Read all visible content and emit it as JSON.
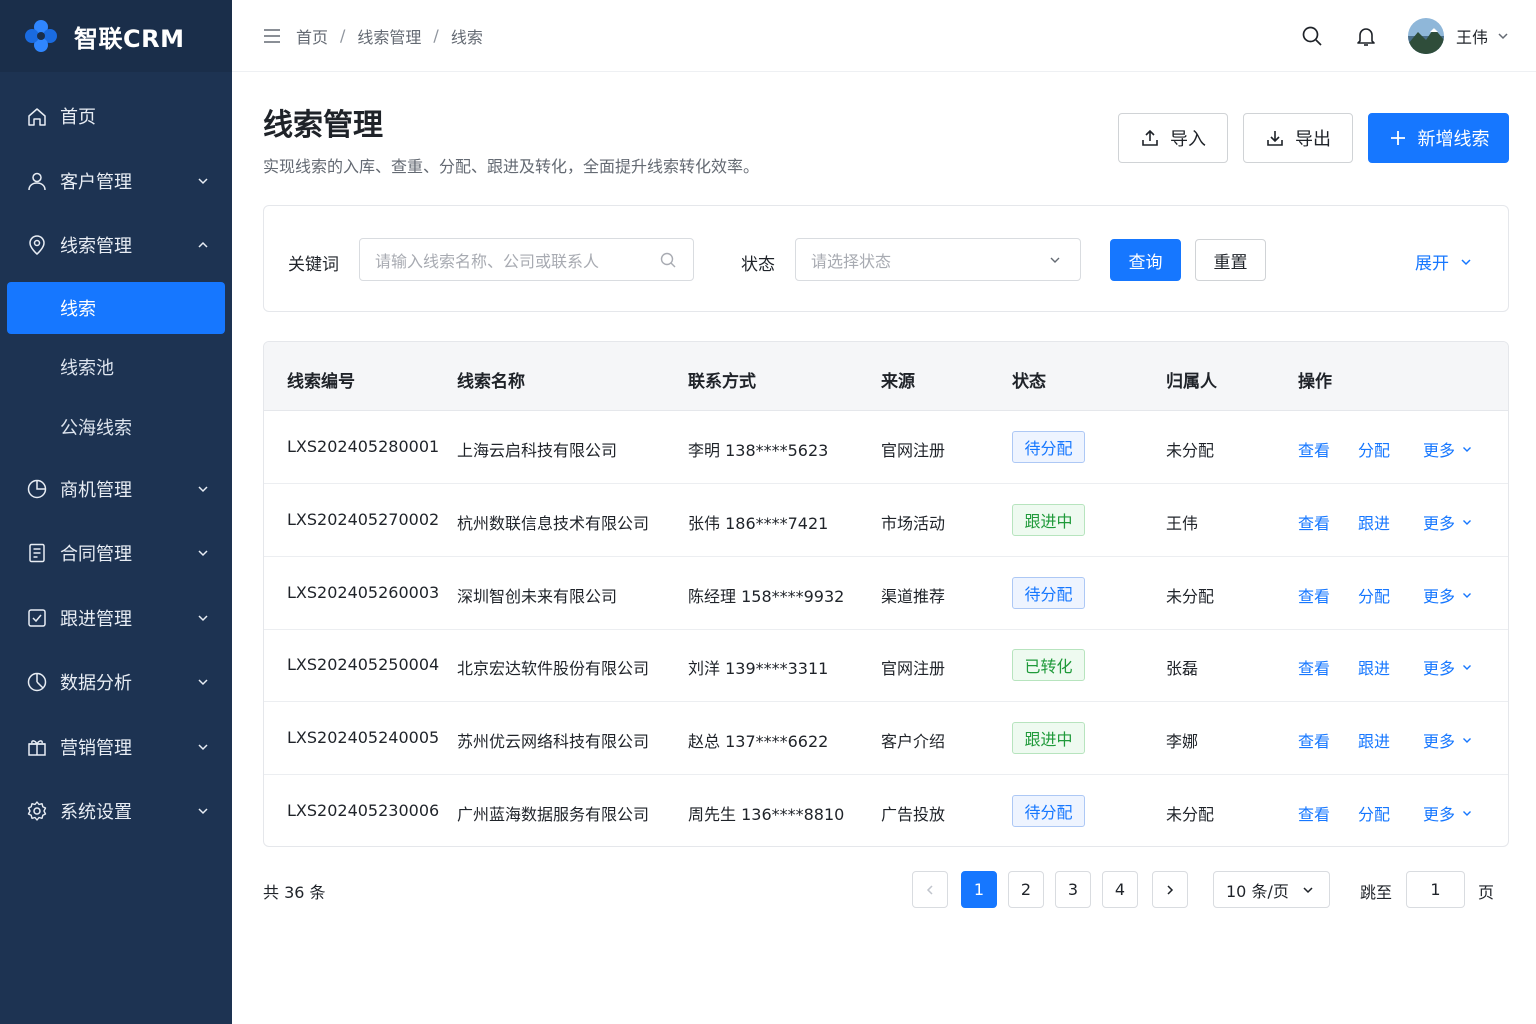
{
  "app": {
    "name": "智联CRM"
  },
  "sidebar": {
    "items": [
      {
        "label": "首页",
        "icon": "home-icon",
        "expandable": false
      },
      {
        "label": "客户管理",
        "icon": "user-icon",
        "expandable": true,
        "expanded": false
      },
      {
        "label": "线索管理",
        "icon": "lead-icon",
        "expandable": true,
        "expanded": true,
        "children": [
          {
            "label": "线索",
            "active": true
          },
          {
            "label": "线索池",
            "active": false
          },
          {
            "label": "公海线索",
            "active": false
          }
        ]
      },
      {
        "label": "商机管理",
        "icon": "pie-icon",
        "expandable": true,
        "expanded": false
      },
      {
        "label": "合同管理",
        "icon": "contract-icon",
        "expandable": true,
        "expanded": false
      },
      {
        "label": "跟进管理",
        "icon": "followup-icon",
        "expandable": true,
        "expanded": false
      },
      {
        "label": "数据分析",
        "icon": "chart-icon",
        "expandable": true,
        "expanded": false
      },
      {
        "label": "营销管理",
        "icon": "gift-icon",
        "expandable": true,
        "expanded": false
      },
      {
        "label": "系统设置",
        "icon": "gear-icon",
        "expandable": true,
        "expanded": false
      }
    ]
  },
  "header": {
    "breadcrumb": [
      "首页",
      "线索管理",
      "线索"
    ],
    "breadcrumb_sep": "/",
    "user_name": "王伟"
  },
  "page": {
    "title": "线索管理",
    "description": "实现线索的入库、查重、分配、跟进及转化，全面提升线索转化效率。",
    "import_label": "导入",
    "export_label": "导出",
    "add_label": "新增线索"
  },
  "filter": {
    "keyword_label": "关键词",
    "keyword_placeholder": "请输入线索名称、公司或联系人",
    "status_label": "状态",
    "status_placeholder": "请选择状态",
    "query_label": "查询",
    "reset_label": "重置",
    "expand_label": "展开"
  },
  "table": {
    "columns": [
      "线索编号",
      "线索名称",
      "联系方式",
      "来源",
      "状态",
      "归属人",
      "操作"
    ],
    "rows": [
      {
        "id": "LXS202405280001",
        "name": "上海云启科技有限公司",
        "contact": "李明  138****5623",
        "source": "官网注册",
        "status": "待分配",
        "status_type": "pending",
        "owner": "未分配",
        "action1": "查看",
        "action2": "分配",
        "more": "更多"
      },
      {
        "id": "LXS202405270002",
        "name": "杭州数联信息技术有限公司",
        "contact": "张伟  186****7421",
        "source": "市场活动",
        "status": "跟进中",
        "status_type": "following",
        "owner": "王伟",
        "action1": "查看",
        "action2": "跟进",
        "more": "更多"
      },
      {
        "id": "LXS202405260003",
        "name": "深圳智创未来有限公司",
        "contact": "陈经理  158****9932",
        "source": "渠道推荐",
        "status": "待分配",
        "status_type": "pending",
        "owner": "未分配",
        "action1": "查看",
        "action2": "分配",
        "more": "更多"
      },
      {
        "id": "LXS202405250004",
        "name": "北京宏达软件股份有限公司",
        "contact": "刘洋  139****3311",
        "source": "官网注册",
        "status": "已转化",
        "status_type": "converted",
        "owner": "张磊",
        "action1": "查看",
        "action2": "跟进",
        "more": "更多"
      },
      {
        "id": "LXS202405240005",
        "name": "苏州优云网络科技有限公司",
        "contact": "赵总  137****6622",
        "source": "客户介绍",
        "status": "跟进中",
        "status_type": "following",
        "owner": "李娜",
        "action1": "查看",
        "action2": "跟进",
        "more": "更多"
      },
      {
        "id": "LXS202405230006",
        "name": "广州蓝海数据服务有限公司",
        "contact": "周先生  136****8810",
        "source": "广告投放",
        "status": "待分配",
        "status_type": "pending",
        "owner": "未分配",
        "action1": "查看",
        "action2": "分配",
        "more": "更多"
      }
    ]
  },
  "status_colors": {
    "pending": {
      "bg": "#eef4ff",
      "border": "#adc8f5",
      "text": "#1677ff"
    },
    "following": {
      "bg": "#eefaf0",
      "border": "#b7e4be",
      "text": "#1f9a3a"
    },
    "converted": {
      "bg": "#eefaf0",
      "border": "#b7e4be",
      "text": "#1f9a3a"
    }
  },
  "pagination": {
    "total_text": "共 36 条",
    "pages": [
      "1",
      "2",
      "3",
      "4"
    ],
    "current": "1",
    "page_size": "10 条/页",
    "jump_label": "跳至",
    "jump_value": "1",
    "page_suffix": "页"
  },
  "colors": {
    "accent": "#1677ff",
    "sidebar": "#1d3352"
  }
}
